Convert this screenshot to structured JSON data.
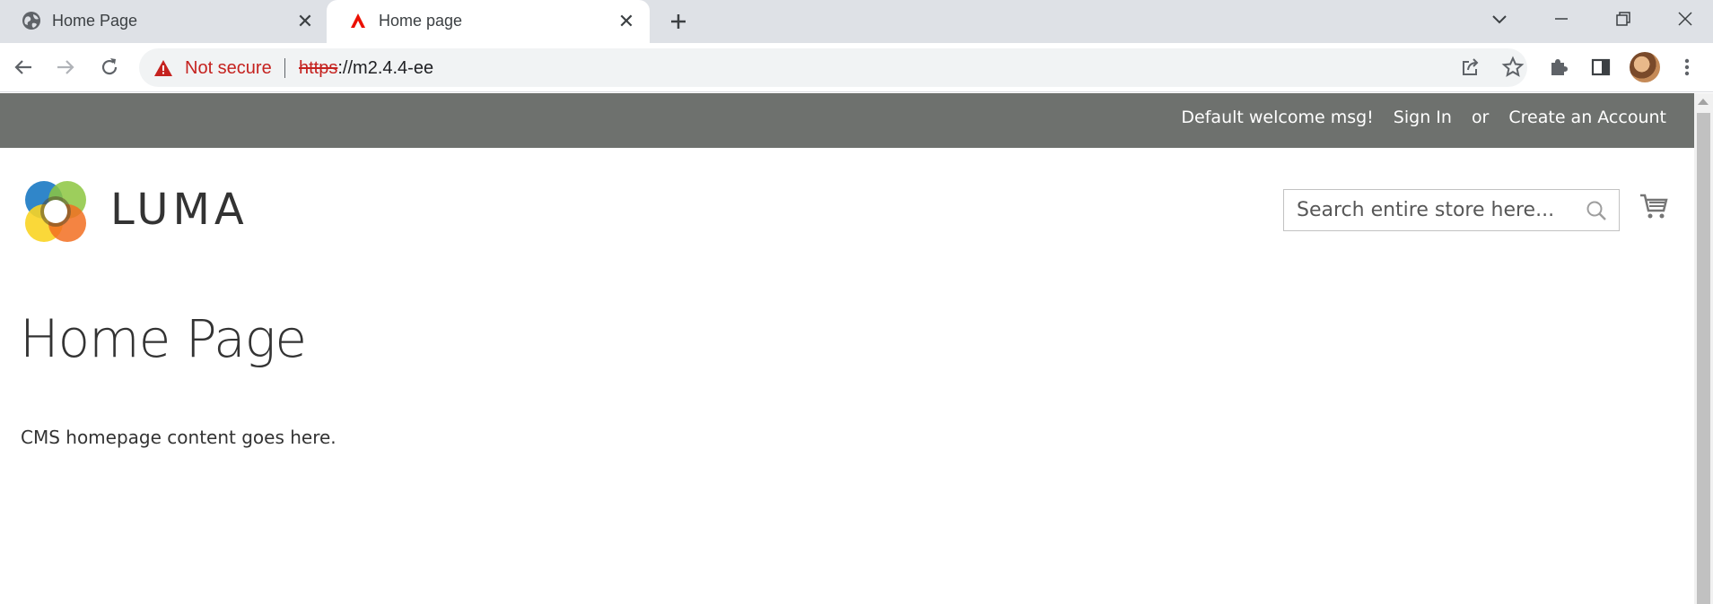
{
  "browser": {
    "tabs": [
      {
        "title": "Home Page",
        "icon": "globe-icon",
        "active": false
      },
      {
        "title": "Home page",
        "icon": "magento-icon",
        "active": true
      }
    ],
    "security_label": "Not secure",
    "url_scheme": "https",
    "url_rest": "://m2.4.4-ee",
    "colors": {
      "insecure": "#c5221f",
      "tabstrip": "#dee1e6"
    }
  },
  "header": {
    "welcome": "Default welcome msg!",
    "sign_in": "Sign In",
    "or": "or",
    "create_account": "Create an Account",
    "background": "#6e716e"
  },
  "logo": {
    "text": "LUMA"
  },
  "search": {
    "placeholder": "Search entire store here..."
  },
  "page": {
    "title": "Home Page",
    "content": "CMS homepage content goes here."
  }
}
